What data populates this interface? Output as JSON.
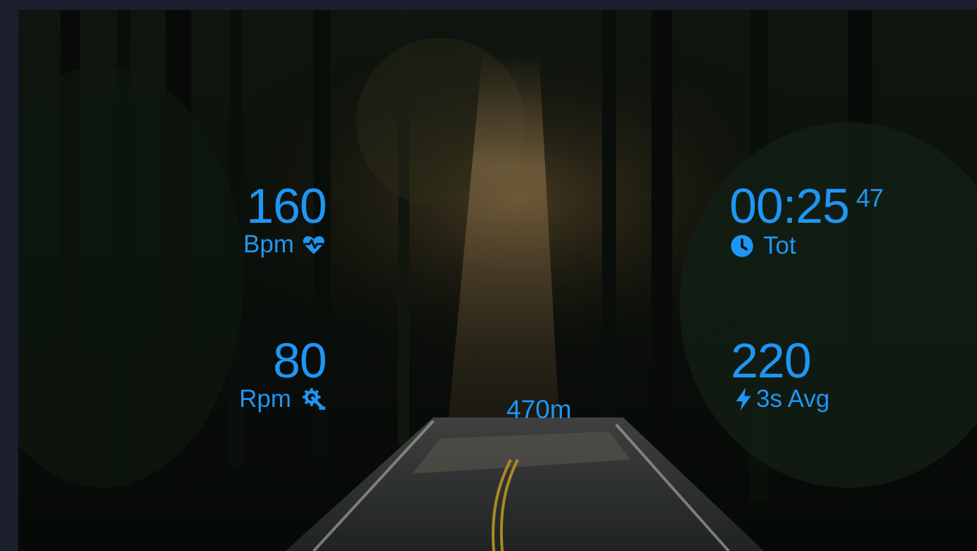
{
  "metrics": {
    "heart_rate": {
      "value": "160",
      "unit": "Bpm",
      "icon": "heart-pulse-icon"
    },
    "cadence": {
      "value": "80",
      "unit": "Rpm",
      "icon": "gear-pedal-icon"
    },
    "elapsed_time": {
      "value": "00:25",
      "seconds": "47",
      "label": "Tot",
      "icon": "clock-icon"
    },
    "power": {
      "value": "220",
      "label": "3s Avg",
      "icon": "lightning-icon"
    },
    "distance": {
      "value": "470m"
    }
  },
  "colors": {
    "accent": "#1e96f5",
    "frame": "#1b1f2d"
  }
}
